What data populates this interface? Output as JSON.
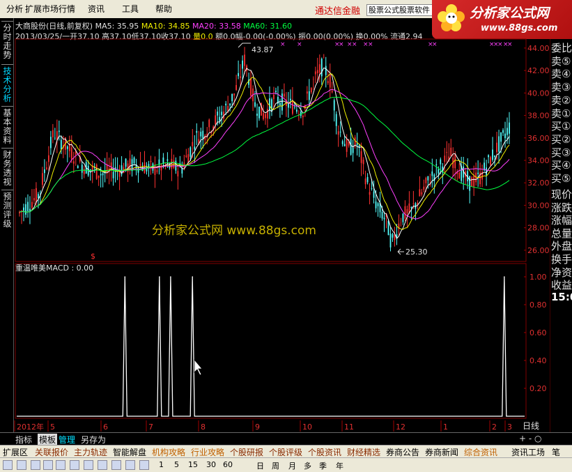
{
  "menubar": {
    "items": [
      {
        "label": "分析",
        "x": 0
      },
      {
        "label": "扩展市场行情",
        "x": 27
      },
      {
        "label": "资讯",
        "x": 117
      },
      {
        "label": "工具",
        "x": 166
      },
      {
        "label": "帮助",
        "x": 214
      }
    ],
    "ad_text": "通达信金融",
    "ad_box_text": "股票公式股票软件",
    "logo_title": "分析家公式网",
    "logo_url": "www.88gs.com"
  },
  "left_tabs": [
    {
      "label": "分时走势"
    },
    {
      "label": "技术分析"
    },
    {
      "label": "基本资料"
    },
    {
      "label": "财务透视"
    },
    {
      "label": "预测评级"
    }
  ],
  "stock": {
    "name": "大商股份(日线,前复权)",
    "ma5_label": "MA5: 35.95",
    "ma10_label": "MA10: 34.85",
    "ma20_label": "MA20: 33.58",
    "ma60_label": "MA60: 31.60",
    "date": "2013/03/25/一",
    "open": "开37.10",
    "high": "高37.10",
    "low": "低37.10",
    "close": "收37.10",
    "volume": "量0.0",
    "amount": "额0.0",
    "change": "幅-0.00(-0.00%)",
    "amplitude": "振0.00(0.00%)",
    "turnover": "换0.00%",
    "float": "流通2.94"
  },
  "price_chart": {
    "high_mark": "43.87",
    "low_mark": "25.30",
    "dollar_mark": "$",
    "watermark": "分析家公式网 www.88gs.com",
    "y_ticks": [
      "44.00",
      "42.00",
      "40.00",
      "38.00",
      "36.00",
      "34.00",
      "32.00",
      "30.00",
      "28.00",
      "26.00"
    ]
  },
  "indicator": {
    "title": "重温唯美MACD : 0.00",
    "y_ticks": [
      "1.00",
      "0.80",
      "0.60",
      "0.40",
      "0.20"
    ]
  },
  "x_axis": {
    "labels": [
      "2012年",
      "5",
      "6",
      "7",
      "8",
      "9",
      "10",
      "11",
      "12",
      "1",
      "2",
      "3"
    ],
    "period": "日线"
  },
  "chart_data": {
    "type": "line",
    "title": "重温唯美MACD",
    "ylim": [
      0,
      1
    ],
    "spikes_at_fraction_of_axis": [
      0.213,
      0.281,
      0.303,
      0.346,
      0.96
    ],
    "values_at_spikes": [
      1,
      1,
      1,
      1,
      1
    ],
    "baseline": 0
  },
  "right_panel": {
    "items": [
      "委比",
      "卖⑤",
      "卖④",
      "卖③",
      "卖②",
      "卖①",
      "买①",
      "买②",
      "买③",
      "买④",
      "买⑤",
      "现价",
      "涨跌",
      "涨幅",
      "总量",
      "外盘",
      "换手",
      "净资",
      "收益",
      "15:0"
    ]
  },
  "bottom_tabs": [
    {
      "label": "指标",
      "style": "normal"
    },
    {
      "label": "模板",
      "style": "active"
    },
    {
      "label": "管理",
      "style": "cyan"
    },
    {
      "label": "另存为",
      "style": "normal"
    }
  ],
  "zoom_controls": "+ - ○",
  "link_bar": [
    {
      "label": "扩展区",
      "style": "normal"
    },
    {
      "label": "关联报价",
      "style": "dark"
    },
    {
      "label": "主力轨迹",
      "style": "dark"
    },
    {
      "label": "智能解盘",
      "style": "normal"
    },
    {
      "label": "机构攻略",
      "style": "orange"
    },
    {
      "label": "行业攻略",
      "style": "orange"
    },
    {
      "label": "个股研报",
      "style": "dark"
    },
    {
      "label": "个股评级",
      "style": "dark"
    },
    {
      "label": "个股资讯",
      "style": "dark"
    },
    {
      "label": "财经精选",
      "style": "dark"
    },
    {
      "label": "券商公告",
      "style": "normal"
    },
    {
      "label": "券商新闻",
      "style": "normal"
    },
    {
      "label": "综合资讯",
      "style": "orange"
    },
    {
      "label": "资讯工场",
      "style": "normal"
    },
    {
      "label": "笔",
      "style": "normal"
    }
  ],
  "toolbar": {
    "periods": [
      "1",
      "5",
      "15",
      "30",
      "60",
      "日",
      "周",
      "月",
      "多",
      "季",
      "年"
    ]
  }
}
